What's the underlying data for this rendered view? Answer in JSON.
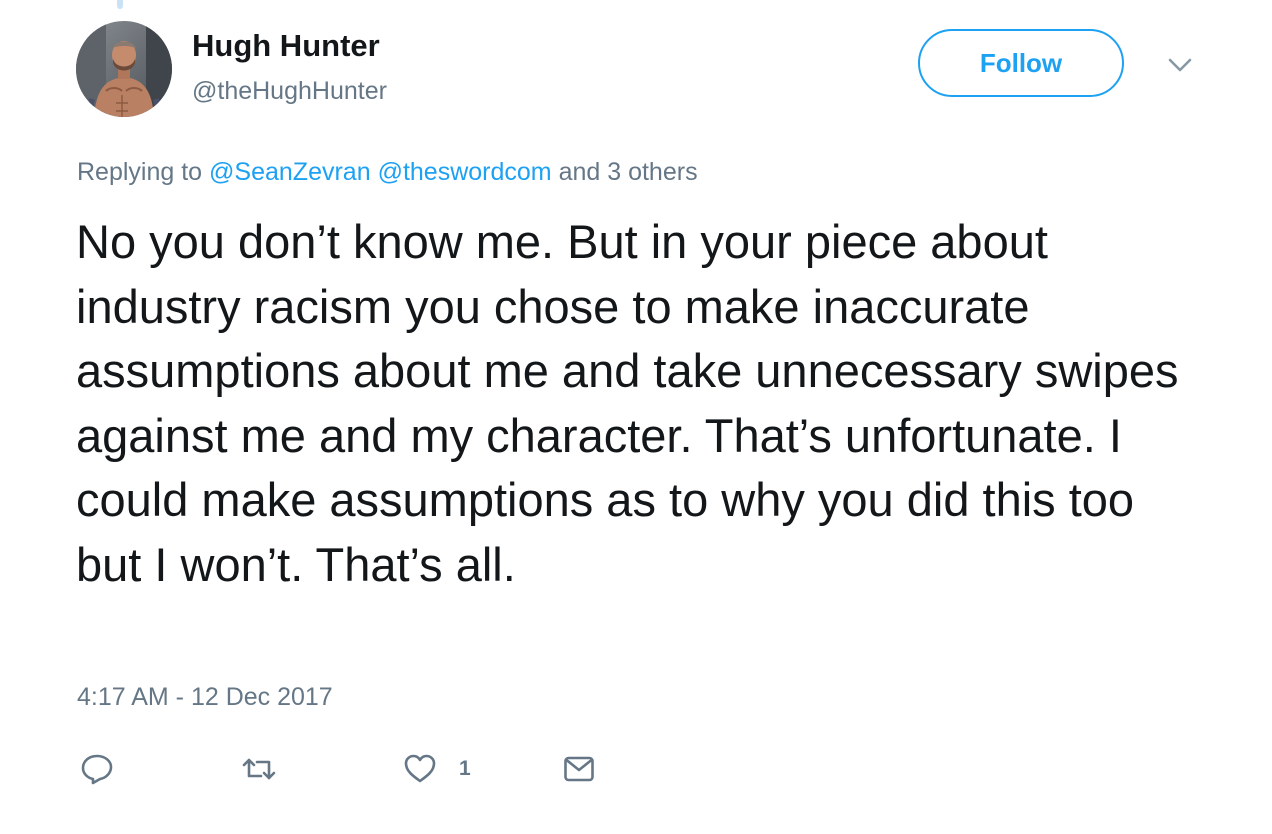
{
  "author": {
    "name": "Hugh Hunter",
    "handle": "@theHughHunter",
    "avatar_icon": "profile-photo"
  },
  "header": {
    "follow_label": "Follow",
    "menu_icon": "chevron-down-icon"
  },
  "reply": {
    "prefix": "Replying to",
    "mention_1": "@SeanZevran",
    "mention_2": "@theswordcom",
    "suffix": "and 3 others"
  },
  "tweet": {
    "text": "No you don’t know me. But in your piece about industry racism you chose to make inaccurate assumptions about me and take unnecessary swipes against me and my character. That’s unfortunate. I could make assumptions as to why you did this too but I won’t. That’s all.",
    "timestamp": "4:17 AM - 12 Dec 2017"
  },
  "actions": {
    "reply_icon": "reply-icon",
    "retweet_icon": "retweet-icon",
    "like_icon": "heart-icon",
    "like_count": "1",
    "dm_icon": "envelope-icon"
  },
  "colors": {
    "accent": "#1da1f2",
    "text": "#14171a",
    "secondary": "#657786"
  }
}
